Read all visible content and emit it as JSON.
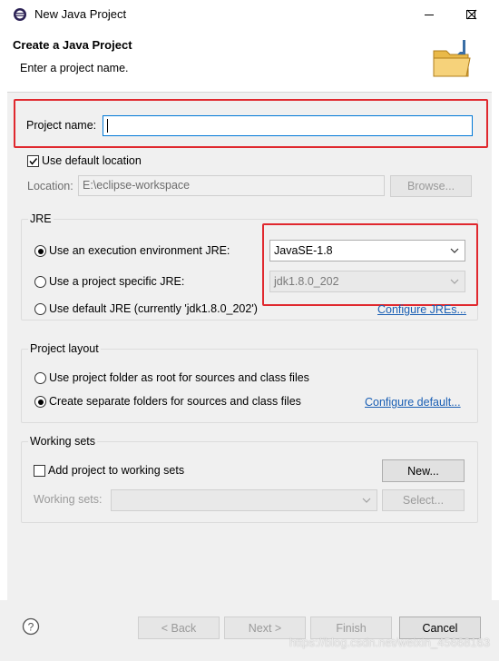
{
  "window": {
    "title": "New Java Project"
  },
  "banner": {
    "title": "Create a Java Project",
    "message": "Enter a project name."
  },
  "project": {
    "name_label": "Project name:",
    "name_value": ""
  },
  "location": {
    "use_default_label": "Use default location",
    "use_default_checked": true,
    "label": "Location:",
    "value": "E:\\eclipse-workspace",
    "browse_label": "Browse..."
  },
  "jre": {
    "group_title": "JRE",
    "option_env": "Use an execution environment JRE:",
    "option_specific": "Use a project specific JRE:",
    "option_default": "Use default JRE (currently 'jdk1.8.0_202')",
    "env_value": "JavaSE-1.8",
    "specific_value": "jdk1.8.0_202",
    "configure_link": "Configure JREs...",
    "selected": "env"
  },
  "layout": {
    "group_title": "Project layout",
    "option_root": "Use project folder as root for sources and class files",
    "option_separate": "Create separate folders for sources and class files",
    "configure_link": "Configure default...",
    "selected": "separate"
  },
  "working_sets": {
    "group_title": "Working sets",
    "add_label": "Add project to working sets",
    "add_checked": false,
    "new_label": "New...",
    "sets_label": "Working sets:",
    "sets_value": "",
    "select_label": "Select..."
  },
  "footer": {
    "help_icon": "help-icon",
    "back_label": "< Back",
    "next_label": "Next >",
    "finish_label": "Finish",
    "cancel_label": "Cancel"
  },
  "watermark": "https://blog.csdn.net/weixin_45668163",
  "colors": {
    "highlight_red": "#e0282e",
    "focus_blue": "#0078d7",
    "link_blue": "#1a5fb4",
    "dialog_bg": "#f0f0f0"
  }
}
